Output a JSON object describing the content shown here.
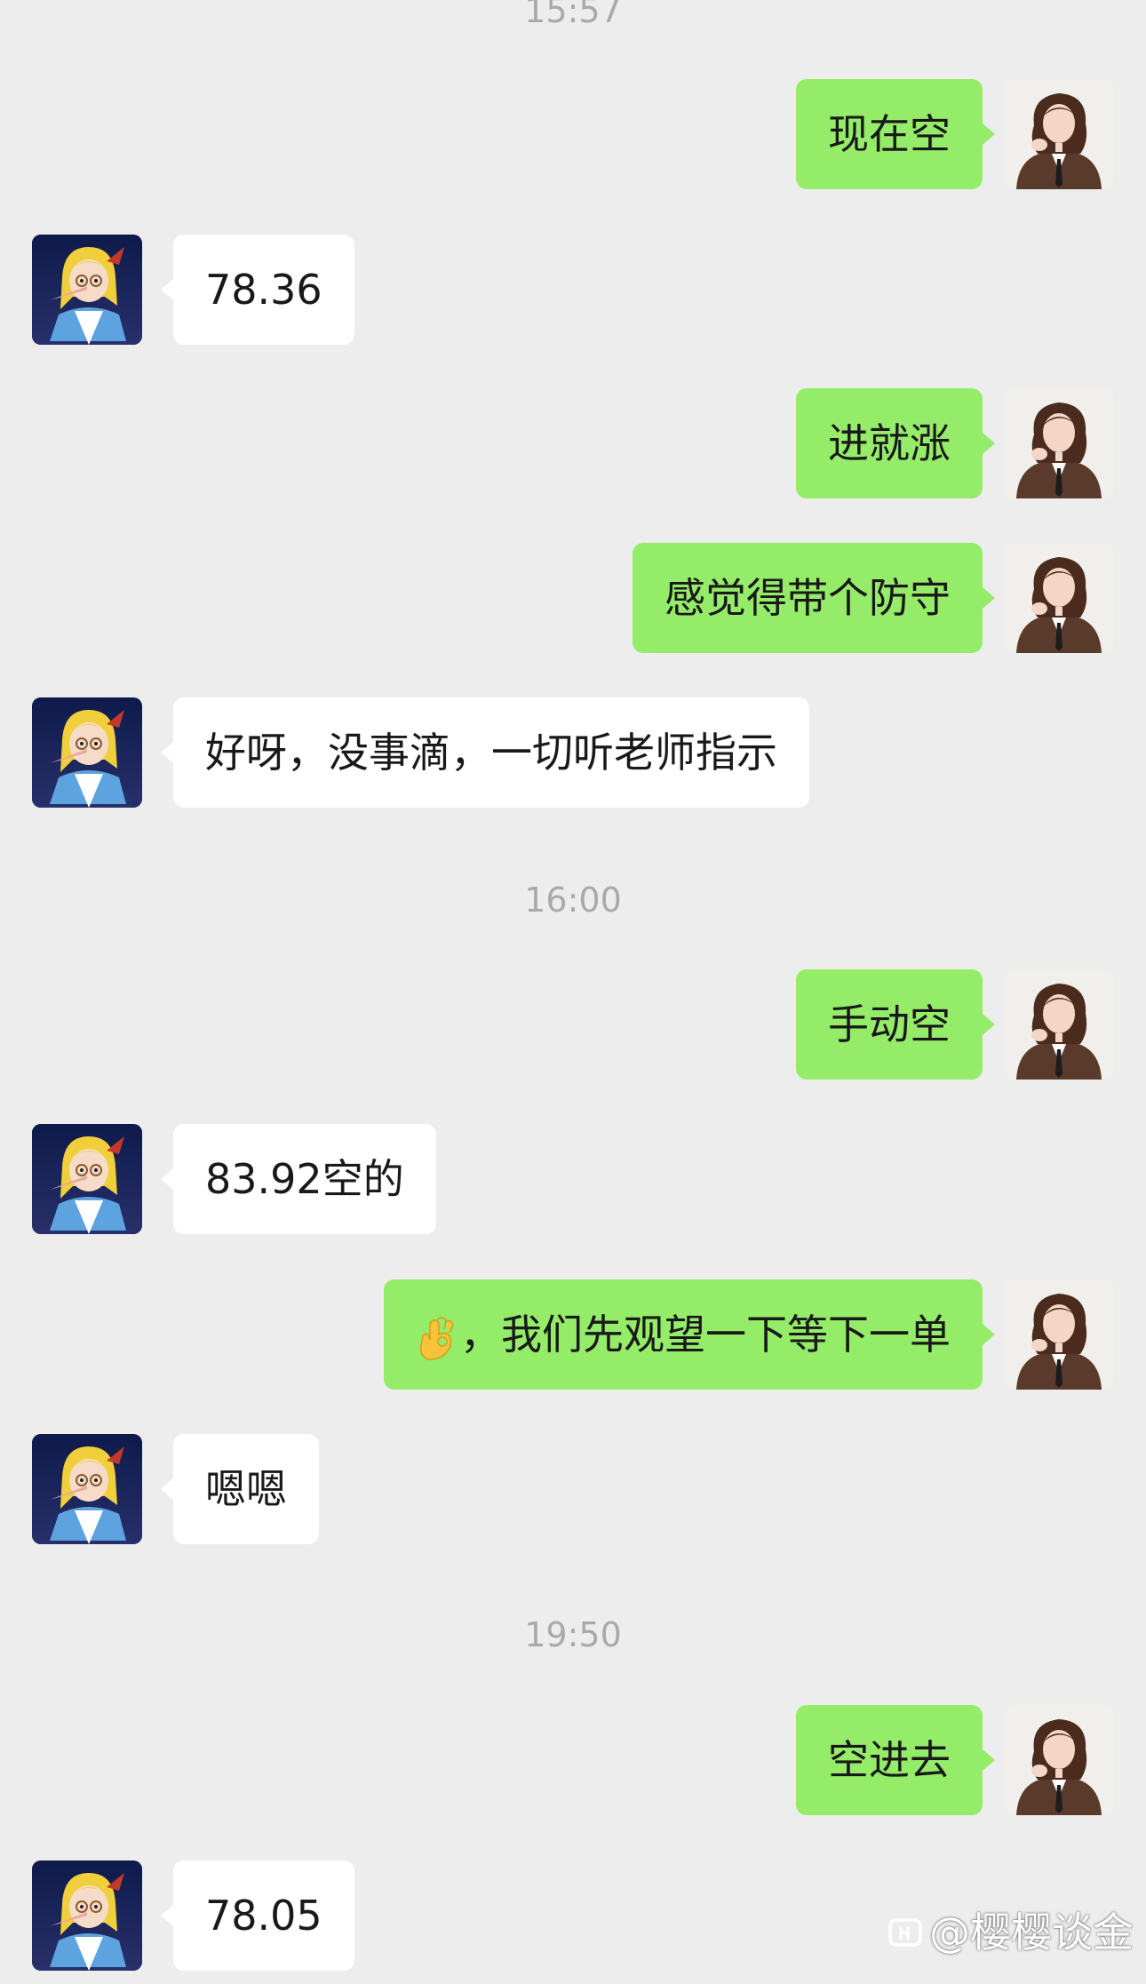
{
  "timestamps": {
    "t1": "15:57",
    "t2": "16:00",
    "t3": "19:50"
  },
  "messages": [
    {
      "side": "sent",
      "text": "现在空"
    },
    {
      "side": "recv",
      "text": "78.36"
    },
    {
      "side": "sent",
      "text": "进就涨"
    },
    {
      "side": "sent",
      "text": "感觉得带个防守"
    },
    {
      "side": "recv",
      "text": "好呀，没事滴，一切听老师指示"
    },
    {
      "side": "sent",
      "text": "手动空"
    },
    {
      "side": "recv",
      "text": "83.92空的"
    },
    {
      "side": "sent",
      "emoji": "ok-hand",
      "text": "，我们先观望一下等下一单"
    },
    {
      "side": "recv",
      "text": "嗯嗯"
    },
    {
      "side": "sent",
      "text": "空进去"
    },
    {
      "side": "recv",
      "text": "78.05"
    }
  ],
  "watermark": {
    "text": "@樱樱谈金"
  },
  "colors": {
    "background": "#ededed",
    "sent_bubble": "#95ec69",
    "recv_bubble": "#ffffff",
    "timestamp_text": "#a9a9a9"
  }
}
